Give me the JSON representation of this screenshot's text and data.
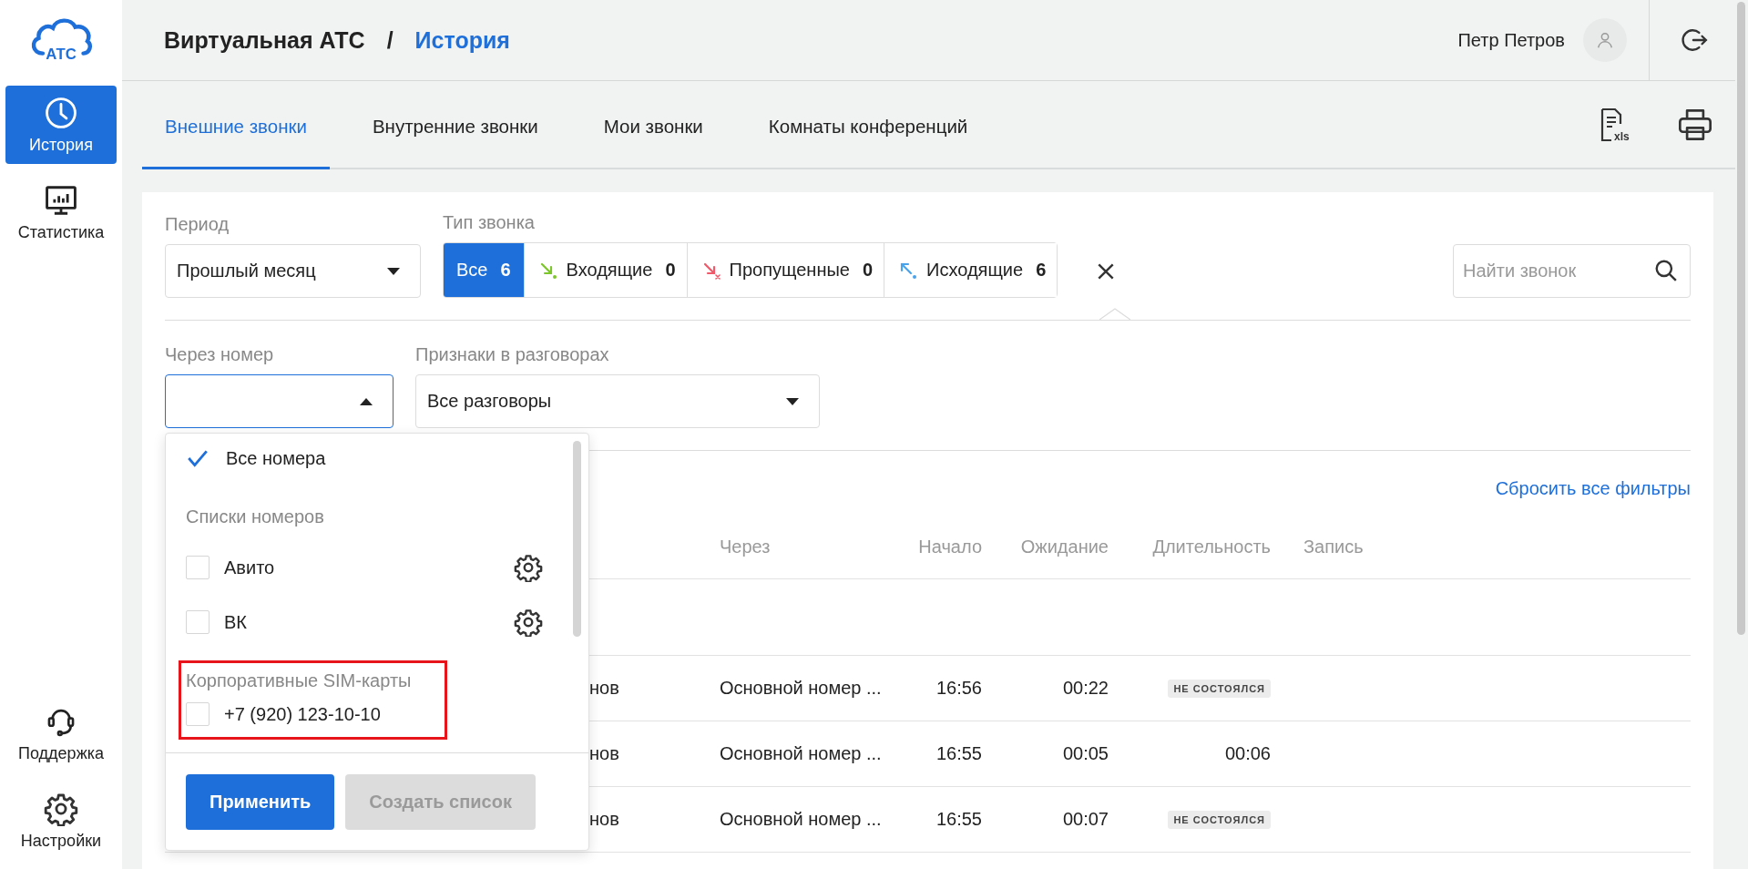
{
  "logo": {
    "text": "АТС"
  },
  "sidebar": {
    "items": [
      {
        "label": "История",
        "selected": true
      },
      {
        "label": "Статистика",
        "selected": false
      }
    ],
    "bottom_items": [
      {
        "label": "Поддержка"
      },
      {
        "label": "Настройки"
      }
    ]
  },
  "header": {
    "breadcrumb": [
      "Виртуальная АТС",
      "История"
    ],
    "separator": "/",
    "user": "Петр Петров"
  },
  "tabs": [
    {
      "label": "Внешние звонки",
      "selected": true
    },
    {
      "label": "Внутренние звонки",
      "selected": false
    },
    {
      "label": "Мои звонки",
      "selected": false
    },
    {
      "label": "Комнаты конференций",
      "selected": false
    }
  ],
  "export": {
    "label": "xls"
  },
  "filters": {
    "period": {
      "label": "Период",
      "value": "Прошлый месяц"
    },
    "call_type": {
      "label": "Тип звонка",
      "options": [
        {
          "kind": "all",
          "label": "Все",
          "count": "6",
          "selected": true
        },
        {
          "kind": "incoming",
          "label": "Входящие",
          "count": "0",
          "selected": false
        },
        {
          "kind": "missed",
          "label": "Пропущенные",
          "count": "0",
          "selected": false
        },
        {
          "kind": "outgoing",
          "label": "Исходящие",
          "count": "6",
          "selected": false
        }
      ]
    },
    "search": {
      "placeholder": "Найти звонок"
    },
    "via_number": {
      "label": "Через номер",
      "expanded": true
    },
    "features": {
      "label": "Признаки в разговорах",
      "value": "Все разговоры"
    }
  },
  "number_dropdown": {
    "all": {
      "label": "Все номера",
      "checked": true
    },
    "sections": [
      {
        "title": "Списки номеров",
        "highlighted": false,
        "items": [
          {
            "label": "Авито",
            "checked": false,
            "settings": true
          },
          {
            "label": "ВК",
            "checked": false,
            "settings": true
          }
        ]
      },
      {
        "title": "Корпоративные SIM-карты",
        "highlighted": true,
        "items": [
          {
            "label": "+7 (920) 123-10-10",
            "checked": false,
            "settings": false
          }
        ]
      }
    ],
    "buttons": [
      {
        "label": "Применить",
        "disabled": false
      },
      {
        "label": "Создать список",
        "disabled": true
      }
    ]
  },
  "reset_link": "Сбросить все фильтры",
  "table": {
    "columns": [
      "Через",
      "Начало",
      "Ожидание",
      "Длительность",
      "Запись"
    ],
    "rows": [
      {
        "column_1": "нов",
        "via": "Основной номер ...",
        "start": "16:56",
        "wait": "00:22",
        "duration": {
          "kind": "status",
          "text": "НЕ СОСТОЯЛСЯ"
        }
      },
      {
        "column_1": "нов",
        "via": "Основной номер ...",
        "start": "16:55",
        "wait": "00:05",
        "duration": {
          "kind": "time",
          "text": "00:06"
        }
      },
      {
        "column_1": "нов",
        "via": "Основной номер ...",
        "start": "16:55",
        "wait": "00:07",
        "duration": {
          "kind": "status",
          "text": "НЕ СОСТОЯЛСЯ"
        }
      }
    ]
  }
}
